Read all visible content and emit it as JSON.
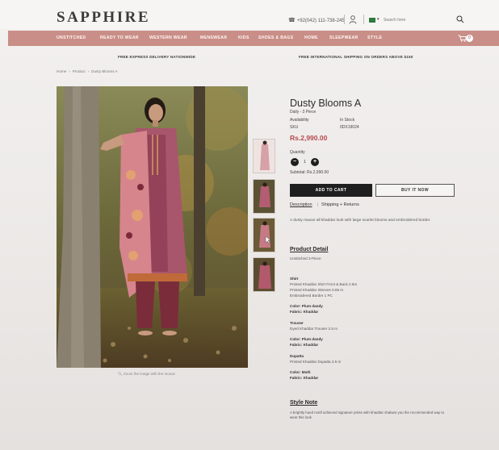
{
  "header": {
    "logo": "SAPPHIRE",
    "phone": "+92(042) 111-738-245",
    "search_placeholder": "Search here"
  },
  "nav": {
    "items": [
      "UNSTITCHED",
      "READY TO WEAR",
      "WESTERN WEAR",
      "MENSWEAR",
      "KIDS",
      "SHOES & BAGS",
      "HOME",
      "SLEEPWEAR",
      "STYLE"
    ],
    "cart_count": "0"
  },
  "promo": {
    "left": "FREE EXPRESS DELIVERY NATIONWIDE",
    "right": "FREE INTERNATIONAL SHIPPING ON ORDERS ABOVE $150"
  },
  "breadcrumb": [
    "Home",
    "›",
    "Product",
    "›",
    "Dusty Blooms A"
  ],
  "gallery": {
    "zoom_hint": "Zoom the image with the mouse"
  },
  "product": {
    "title": "Dusty Blooms A",
    "subtitle": "Daily - 3 Piece",
    "availability_label": "Availability",
    "availability_value": "In Stock",
    "sku_label": "SKU",
    "sku_value": "0DX19024",
    "price": "Rs.2,990.00",
    "quantity_label": "Quantity",
    "quantity_value": "1",
    "subtotal_label": "Subtotal:",
    "subtotal_value": "Rs.2,990.00",
    "add_to_cart": "ADD TO CART",
    "buy_now": "BUY IT NOW",
    "tab_description": "Description",
    "tab_shipping": "Shipping + Returns",
    "description": "A dusty mauve all khaddar look with large scarlet blooms and embroidered border."
  },
  "details": {
    "heading": "Product Detail",
    "subheading": "Unstitched 3-Piece",
    "shirt_heading": "Shirt",
    "shirt_lines": [
      "Printed Khaddar Shirt Front & Back 2.5m",
      "Printed Khaddar Sleeves 0.65 m",
      "Embroidered Border 1 PC"
    ],
    "shirt_color": "Color: Plum dandy",
    "shirt_fabric": "Fabric: Khaddar",
    "trouser_heading": "Trouser",
    "trouser_line": "Dyed Khaddar Trouser 2.5 m",
    "trouser_color": "Color: Plum dandy",
    "trouser_fabric": "Fabric: Khaddar",
    "dupatta_heading": "Dupatta",
    "dupatta_line": "Printed Khaddar Dupatta 2.5 m",
    "dupatta_color": "Color: Multi",
    "dupatta_fabric": "Fabric: Khaddar"
  },
  "style_note": {
    "heading": "Style Note",
    "text": "A brightly hued motif achieved signature prints with khaddar shalwar you the recommended way to wear this look."
  },
  "colors": {
    "nav_bg": "#c98e87",
    "price": "#b44a4a",
    "button_dark": "#1f1f1f"
  }
}
